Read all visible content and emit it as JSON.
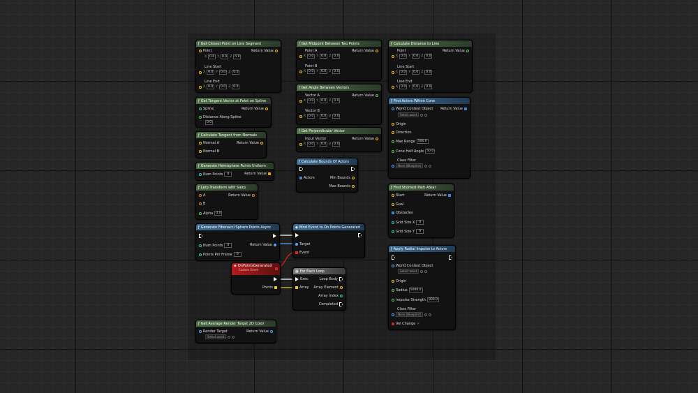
{
  "axis_labels": {
    "x": "X",
    "y": "Y",
    "z": "Z"
  },
  "nodes": {
    "closest_point": {
      "title": "Get Closest Point on Line Segment",
      "point": "Point",
      "line_start": "Line Start",
      "line_end": "Line End",
      "return": "Return Value",
      "vals": {
        "px": "0.0",
        "py": "0.0",
        "pz": "0.0",
        "sx": "0.0",
        "sy": "0.0",
        "sz": "0.0",
        "ex": "0.0",
        "ey": "0.0",
        "ez": "0.0"
      }
    },
    "midpoint": {
      "title": "Get Midpoint Between Two Points",
      "a": "Point A",
      "b": "Point B",
      "return": "Return Value",
      "vals": {
        "ax": "0.0",
        "ay": "0.0",
        "az": "0.0",
        "bx": "0.0",
        "by": "0.0",
        "bz": "0.0"
      }
    },
    "distance_line": {
      "title": "Calculate Distance to Line",
      "point": "Point",
      "line_start": "Line Start",
      "line_end": "Line End",
      "return": "Return Value",
      "vals": {
        "px": "0.0",
        "py": "0.0",
        "pz": "0.0",
        "sx": "0.0",
        "sy": "0.0",
        "sz": "0.0",
        "ex": "0.0",
        "ey": "0.0",
        "ez": "0.0"
      }
    },
    "tangent_spline": {
      "title": "Get Tangent Vector at Point on Spline",
      "spline": "Spline",
      "distance": "Distance Along Spline",
      "return": "Return Value",
      "dist_val": "0.0"
    },
    "angle_vectors": {
      "title": "Get Angle Between Vectors",
      "a": "Vector A",
      "b": "Vector B",
      "return": "Return Value",
      "vals": {
        "ax": "0.0",
        "ay": "0.0",
        "az": "0.0",
        "bx": "0.0",
        "by": "0.0",
        "bz": "0.0"
      }
    },
    "find_cone": {
      "title": "Find Actors Within Cone",
      "world": "World Context Object",
      "select": "Select asset",
      "origin": "Origin",
      "direction": "Direction",
      "max_range": "Max Range",
      "max_range_val": "500.0",
      "half_angle": "Cone Half Angle",
      "half_angle_val": "50.0",
      "class_filter": "Class Filter",
      "class_val": "None (Blueprint)",
      "return": "Return Value"
    },
    "tangent_normals": {
      "title": "Calculate Tangent from Normals",
      "a": "Normal A",
      "b": "Normal B",
      "return": "Return Value"
    },
    "perpendicular": {
      "title": "Get Perpendicular Vector",
      "input": "Input Vector",
      "return": "Return Value",
      "vals": {
        "x": "0.0",
        "y": "0.0",
        "z": "0.0"
      }
    },
    "hemisphere": {
      "title": "Generate Hemisphere Points Uniform",
      "num": "Num Points",
      "num_val": "0",
      "return": "Return Value"
    },
    "bounds": {
      "title": "Calculate Bounds Of Actors",
      "actors": "Actors",
      "min": "Min Bounds",
      "max": "Max Bounds"
    },
    "lerp": {
      "title": "Lerp Transform with Slerp",
      "a": "A",
      "b": "B",
      "alpha": "Alpha",
      "alpha_val": "0.0",
      "return": "Return Value"
    },
    "shortest_path": {
      "title": "Find Shortest Path AStar",
      "start": "Start",
      "goal": "Goal",
      "obstacles": "Obstacles",
      "gx": "Grid Size X",
      "gx_val": "0",
      "gy": "Grid Size Y",
      "gy_val": "0",
      "return": "Return Value"
    },
    "fibonacci": {
      "title": "Generate Fibonacci Sphere Points Async",
      "num": "Num Points",
      "num_val": "0",
      "per_frame": "Points Per Frame",
      "per_frame_val": "0",
      "return": "Return Value"
    },
    "bind_event": {
      "title": "Bind Event to On Points Generated",
      "target": "Target",
      "event": "Event"
    },
    "custom_event": {
      "title": "OnPointsGenerated",
      "subtitle": "Custom Event",
      "points": "Points"
    },
    "radial": {
      "title": "Apply Radial Impulse to Actors",
      "world": "World Context Object",
      "select": "Select asset",
      "origin": "Origin",
      "radius": "Radius",
      "radius_val": "5000.0",
      "impulse": "Impulse Strength",
      "impulse_val": "900.0",
      "class_filter": "Class Filter",
      "class_val": "None (Blueprint)",
      "vel": "Vel Change"
    },
    "foreach": {
      "title": "For Each Loop",
      "exec": "Exec",
      "array": "Array",
      "loop_body": "Loop Body",
      "element": "Array Element",
      "index": "Array Index",
      "completed": "Completed"
    },
    "render_target": {
      "title": "Get Average Render Target 2D Color",
      "rt": "Render Target",
      "select": "Select asset",
      "return": "Return Value"
    }
  }
}
